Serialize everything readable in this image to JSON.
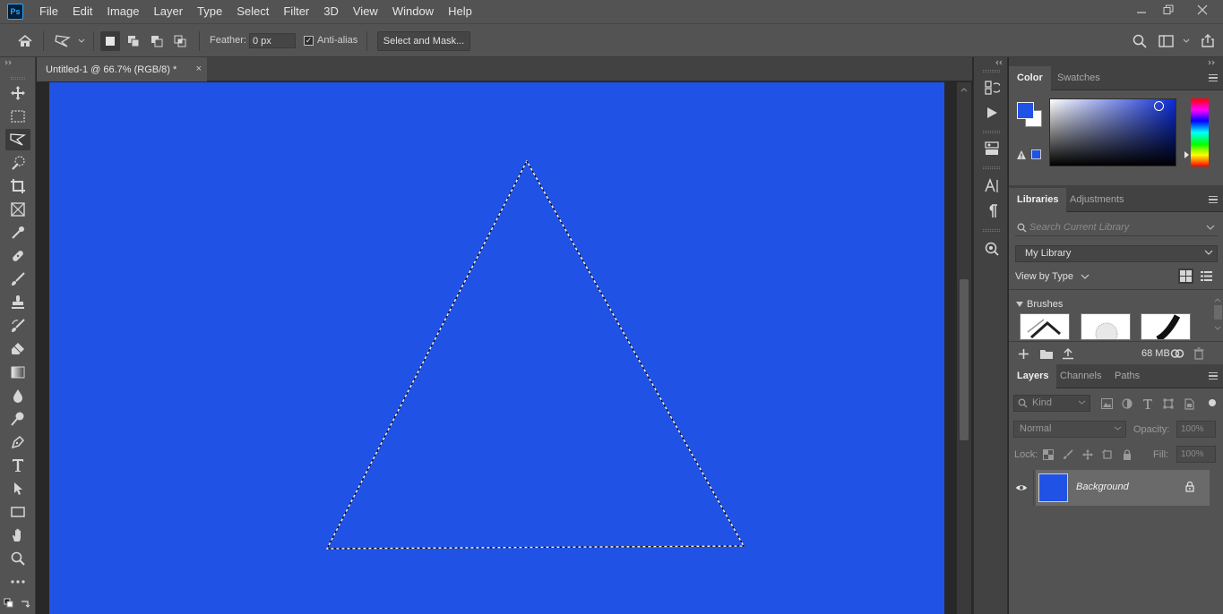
{
  "app": {
    "logo_text": "Ps"
  },
  "menubar": {
    "items": [
      "File",
      "Edit",
      "Image",
      "Layer",
      "Type",
      "Select",
      "Filter",
      "3D",
      "View",
      "Window",
      "Help"
    ]
  },
  "options": {
    "feather_label": "Feather:",
    "feather_value": "0 px",
    "antialias_checked": "✓",
    "antialias_label": "Anti-alias",
    "select_mask_label": "Select and Mask..."
  },
  "document": {
    "tab_title": "Untitled-1 @ 66.7% (RGB/8) *",
    "tab_close": "×",
    "canvas_color": "#2052e6"
  },
  "color_panel": {
    "tabs": [
      "Color",
      "Swatches"
    ],
    "foreground": "#2052e6",
    "background": "#ffffff"
  },
  "libraries_panel": {
    "tabs": [
      "Libraries",
      "Adjustments"
    ],
    "search_placeholder": "Search Current Library",
    "library_selected": "My Library",
    "view_by": "View by Type",
    "section_label": "Brushes",
    "storage": "68 MB"
  },
  "layers_panel": {
    "tabs": [
      "Layers",
      "Channels",
      "Paths"
    ],
    "kind_placeholder": "Kind",
    "blend_mode": "Normal",
    "opacity_label": "Opacity:",
    "opacity_value": "100%",
    "lock_label": "Lock:",
    "fill_label": "Fill:",
    "fill_value": "100%",
    "layers": [
      {
        "name": "Background",
        "color": "#2052e6"
      }
    ]
  },
  "icons": [
    "home-icon",
    "polygonal-lasso-icon",
    "move-tool-icon",
    "marquee-tool-icon",
    "quick-selection-icon",
    "crop-tool-icon",
    "frame-tool-icon",
    "eyedropper-icon",
    "healing-brush-icon",
    "brush-tool-icon",
    "clone-stamp-icon",
    "history-brush-icon",
    "eraser-icon",
    "gradient-icon",
    "blur-icon",
    "dodge-icon",
    "pen-tool-icon",
    "type-tool-icon",
    "path-selection-icon",
    "rectangle-tool-icon",
    "hand-tool-icon",
    "zoom-tool-icon",
    "more-tools-icon",
    "search-icon",
    "workspace-icon",
    "share-icon"
  ]
}
